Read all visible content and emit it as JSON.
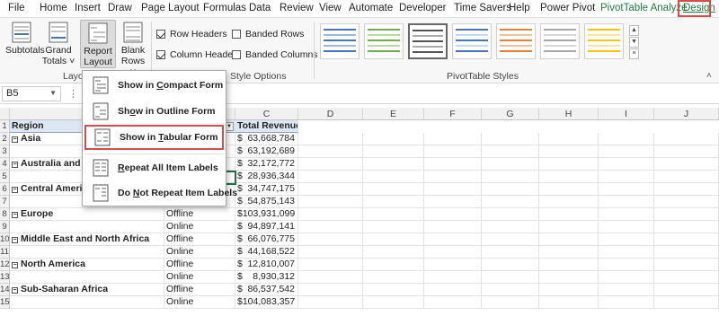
{
  "ribbon_tabs": [
    "File",
    "Home",
    "Insert",
    "Draw",
    "Page Layout",
    "Formulas",
    "Data",
    "Review",
    "View",
    "Automate",
    "Developer",
    "Time Savers",
    "Help",
    "Power Pivot",
    "PivotTable Analyze",
    "Design"
  ],
  "active_tab": "Design",
  "ribbon": {
    "subtotals": "Subtotals",
    "grand_totals_1": "Grand",
    "grand_totals_2": "Totals",
    "report_layout_1": "Report",
    "report_layout_2": "Layout",
    "blank_rows_1": "Blank",
    "blank_rows_2": "Rows",
    "layout_group_label": "Layou",
    "row_headers": "Row Headers",
    "column_headers": "Column Headers",
    "banded_rows": "Banded Rows",
    "banded_columns": "Banded Columns",
    "style_options_label": "Style Options",
    "pivot_styles_label": "PivotTable Styles",
    "row_headers_checked": true,
    "column_headers_checked": true,
    "banded_rows_checked": false,
    "banded_columns_checked": false
  },
  "style_swatch_colors": [
    "#4472c4",
    "#70ad47",
    "#7f7f7f",
    "#4472c4",
    "#ed7d31",
    "#a5a5a5",
    "#ffc000"
  ],
  "formula_bar": {
    "name_box": "B5",
    "dots": "⋮"
  },
  "columns": [
    "C",
    "D",
    "E",
    "F",
    "G",
    "H",
    "I",
    "J"
  ],
  "header_row": {
    "region": "Region",
    "revenue": "Total Revenue"
  },
  "rows": [
    {
      "n": "2",
      "region": "Asia",
      "channel": "",
      "cur": "$",
      "revenue": "63,668,784"
    },
    {
      "n": "3",
      "region": "",
      "channel": "",
      "cur": "$",
      "revenue": "63,192,689"
    },
    {
      "n": "4",
      "region": "Australia and O",
      "channel": "",
      "cur": "$",
      "revenue": "32,172,772"
    },
    {
      "n": "5",
      "region": "",
      "channel": "",
      "cur": "$",
      "revenue": "28,936,344"
    },
    {
      "n": "6",
      "region": "Central America",
      "channel": "",
      "cur": "$",
      "revenue": "34,747,175"
    },
    {
      "n": "7",
      "region": "",
      "channel": "",
      "cur": "$",
      "revenue": "54,875,143"
    },
    {
      "n": "8",
      "region": "Europe",
      "channel": "Offline",
      "cur": "$",
      "revenue": "103,931,099"
    },
    {
      "n": "9",
      "region": "",
      "channel": "Online",
      "cur": "$",
      "revenue": "94,897,141"
    },
    {
      "n": "10",
      "region": "Middle East and North Africa",
      "channel": "Offline",
      "cur": "$",
      "revenue": "66,076,775"
    },
    {
      "n": "11",
      "region": "",
      "channel": "Online",
      "cur": "$",
      "revenue": "44,168,522"
    },
    {
      "n": "12",
      "region": "North America",
      "channel": "Offline",
      "cur": "$",
      "revenue": "12,810,007"
    },
    {
      "n": "13",
      "region": "",
      "channel": "Online",
      "cur": "$",
      "revenue": "8,930,312"
    },
    {
      "n": "14",
      "region": "Sub-Saharan Africa",
      "channel": "Offline",
      "cur": "$",
      "revenue": "86,537,542"
    },
    {
      "n": "15",
      "region": "",
      "channel": "Online",
      "cur": "$",
      "revenue": "104,083,357"
    }
  ],
  "menu": {
    "items": [
      {
        "before": "Show in ",
        "key": "C",
        "after": "ompact Form"
      },
      {
        "before": "Sh",
        "key": "o",
        "after": "w in Outline Form"
      },
      {
        "before": "Show in ",
        "key": "T",
        "after": "abular Form"
      },
      {
        "before": "",
        "key": "R",
        "after": "epeat All Item Labels"
      },
      {
        "before": "Do ",
        "key": "N",
        "after": "ot Repeat Item Labels"
      }
    ],
    "highlighted_index": 2
  },
  "colors": {
    "accent_green": "#1e7145",
    "highlight_red": "#d94a4a",
    "header_blue": "#dde6f3"
  }
}
